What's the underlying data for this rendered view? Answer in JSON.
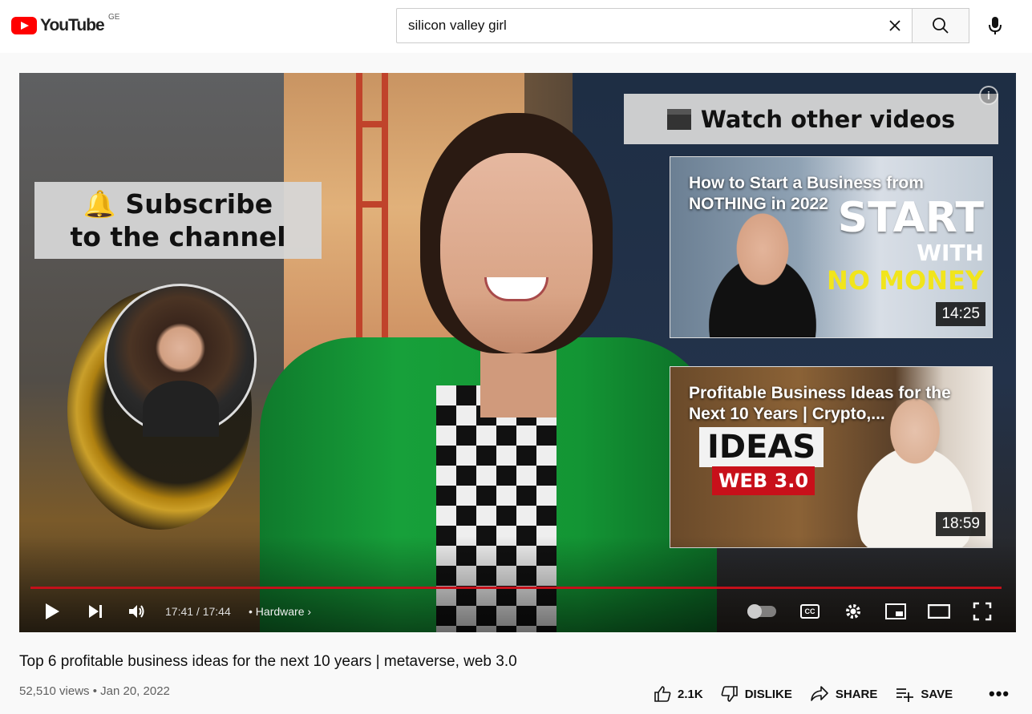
{
  "masthead": {
    "logo_text": "YouTube",
    "country_code": "GE",
    "search_value": "silicon valley girl",
    "icons": [
      "youtube-logo",
      "clear-icon",
      "search-icon",
      "mic-icon"
    ]
  },
  "player": {
    "overlay_subscribe_line1": "🔔 Subscribe",
    "overlay_subscribe_line2": "to the channel",
    "overlay_watch": "Watch other videos",
    "info_label": "i",
    "endcards": [
      {
        "title": "How to Start a Business from NOTHING in 2022",
        "duration": "14:25",
        "thumb_big_1": "START",
        "thumb_big_2": "WITH",
        "thumb_big_3": "NO MONEY"
      },
      {
        "title": "Profitable Business Ideas for the Next 10 Years | Crypto,...",
        "duration": "18:59",
        "thumb_big_1": "IDEAS",
        "thumb_big_2": "WEB 3.0"
      }
    ],
    "progress_fraction": 0.998,
    "time": "17:41 / 17:44",
    "chapter": "• Hardware",
    "cc_label": "CC",
    "accent_color": "#c4101a"
  },
  "video": {
    "title": "Top 6 profitable business ideas for the next 10 years | metaverse, web 3.0",
    "meta": "52,510 views • Jan 20, 2022",
    "actions": {
      "like": "2.1K",
      "dislike": "DISLIKE",
      "share": "SHARE",
      "save": "SAVE",
      "more": "•••"
    }
  }
}
